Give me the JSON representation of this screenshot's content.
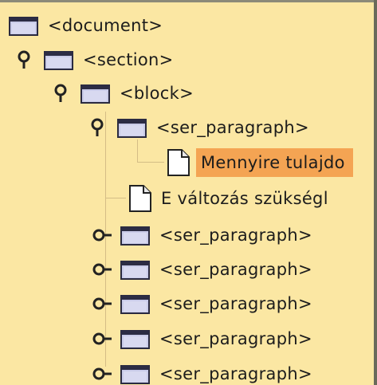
{
  "tree": {
    "nodes": [
      {
        "label": "<document>",
        "icon": "folder-icon",
        "handle": "none"
      },
      {
        "label": "<section>",
        "icon": "folder-icon",
        "handle": "expanded"
      },
      {
        "label": "<block>",
        "icon": "folder-icon",
        "handle": "expanded"
      },
      {
        "label": "<ser_paragraph>",
        "icon": "folder-icon",
        "handle": "expanded"
      },
      {
        "label": "Mennyire tulajdo",
        "icon": "document-icon",
        "handle": "none",
        "selected": true
      },
      {
        "label": "E változás szükségl",
        "icon": "document-icon",
        "handle": "none"
      },
      {
        "label": "<ser_paragraph>",
        "icon": "folder-icon",
        "handle": "collapsed"
      },
      {
        "label": "<ser_paragraph>",
        "icon": "folder-icon",
        "handle": "collapsed"
      },
      {
        "label": "<ser_paragraph>",
        "icon": "folder-icon",
        "handle": "collapsed"
      },
      {
        "label": "<ser_paragraph>",
        "icon": "folder-icon",
        "handle": "collapsed"
      },
      {
        "label": "<ser_paragraph>",
        "icon": "folder-icon",
        "handle": "collapsed"
      }
    ]
  },
  "colors": {
    "background": "#fbe7a3",
    "selection": "#f4a453",
    "folder": "#c9cbe8",
    "tree_line": "#d4bd86"
  }
}
